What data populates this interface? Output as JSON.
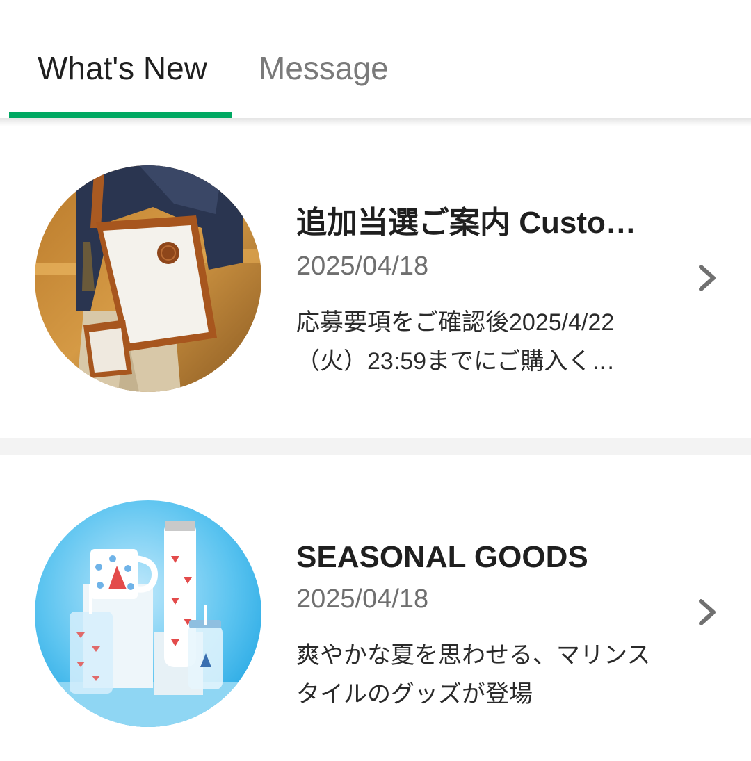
{
  "tabs": [
    {
      "label": "What's New",
      "active": true
    },
    {
      "label": "Message",
      "active": false
    }
  ],
  "accent_color": "#00a862",
  "news": [
    {
      "title": "追加当選ご案内 Custo…",
      "date": "2025/04/18",
      "description": "応募要項をご確認後2025/4/22（火）23:59までにご購入く…",
      "image_icon": "bag-photo"
    },
    {
      "title": "SEASONAL GOODS",
      "date": "2025/04/18",
      "description": "爽やかな夏を思わせる、マリンスタイルのグッズが登場",
      "image_icon": "tumbler-photo"
    }
  ],
  "chevron_icon": "chevron-right-icon"
}
